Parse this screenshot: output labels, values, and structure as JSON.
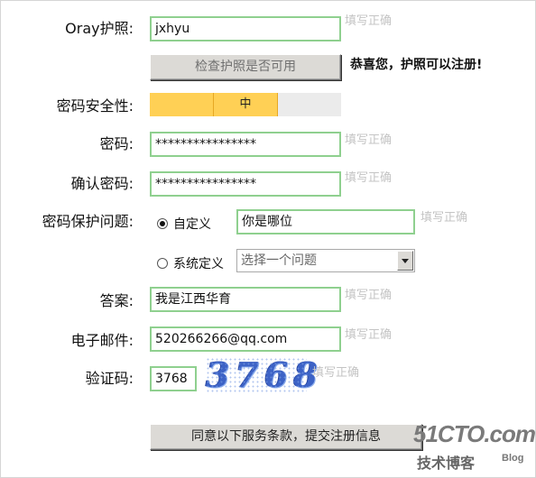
{
  "form": {
    "oray_id": {
      "label": "Oray护照:",
      "value": "jxhyu",
      "hint": "填写正确"
    },
    "check_button_label": "检查护照是否可用",
    "check_message": "恭喜您，护照可以注册!",
    "password_strength": {
      "label": "密码安全性:",
      "level": "中",
      "level_index": 2,
      "levels_total": 3
    },
    "password": {
      "label": "密码:",
      "value": "****************",
      "hint": "填写正确"
    },
    "confirm_password": {
      "label": "确认密码:",
      "value": "****************",
      "hint": "填写正确"
    },
    "security_question": {
      "label": "密码保护问题:",
      "custom_option_label": "自定义",
      "custom_selected": true,
      "custom_value": "你是哪位",
      "hint": "填写正确",
      "system_option_label": "系统定义",
      "system_select_value": "选择一个问题"
    },
    "answer": {
      "label": "答案:",
      "value": "我是江西华育",
      "hint": "填写正确"
    },
    "email": {
      "label": "电子邮件:",
      "value": "520266266@qq.com",
      "hint": "填写正确"
    },
    "captcha": {
      "label": "验证码:",
      "value": "3768",
      "image_text": "3768",
      "hint": "填写正确"
    },
    "submit_button_label": "同意以下服务条款，提交注册信息"
  },
  "watermark": {
    "logo": "51CTO.com",
    "subtitle": "技术博客",
    "blog": "Blog"
  }
}
